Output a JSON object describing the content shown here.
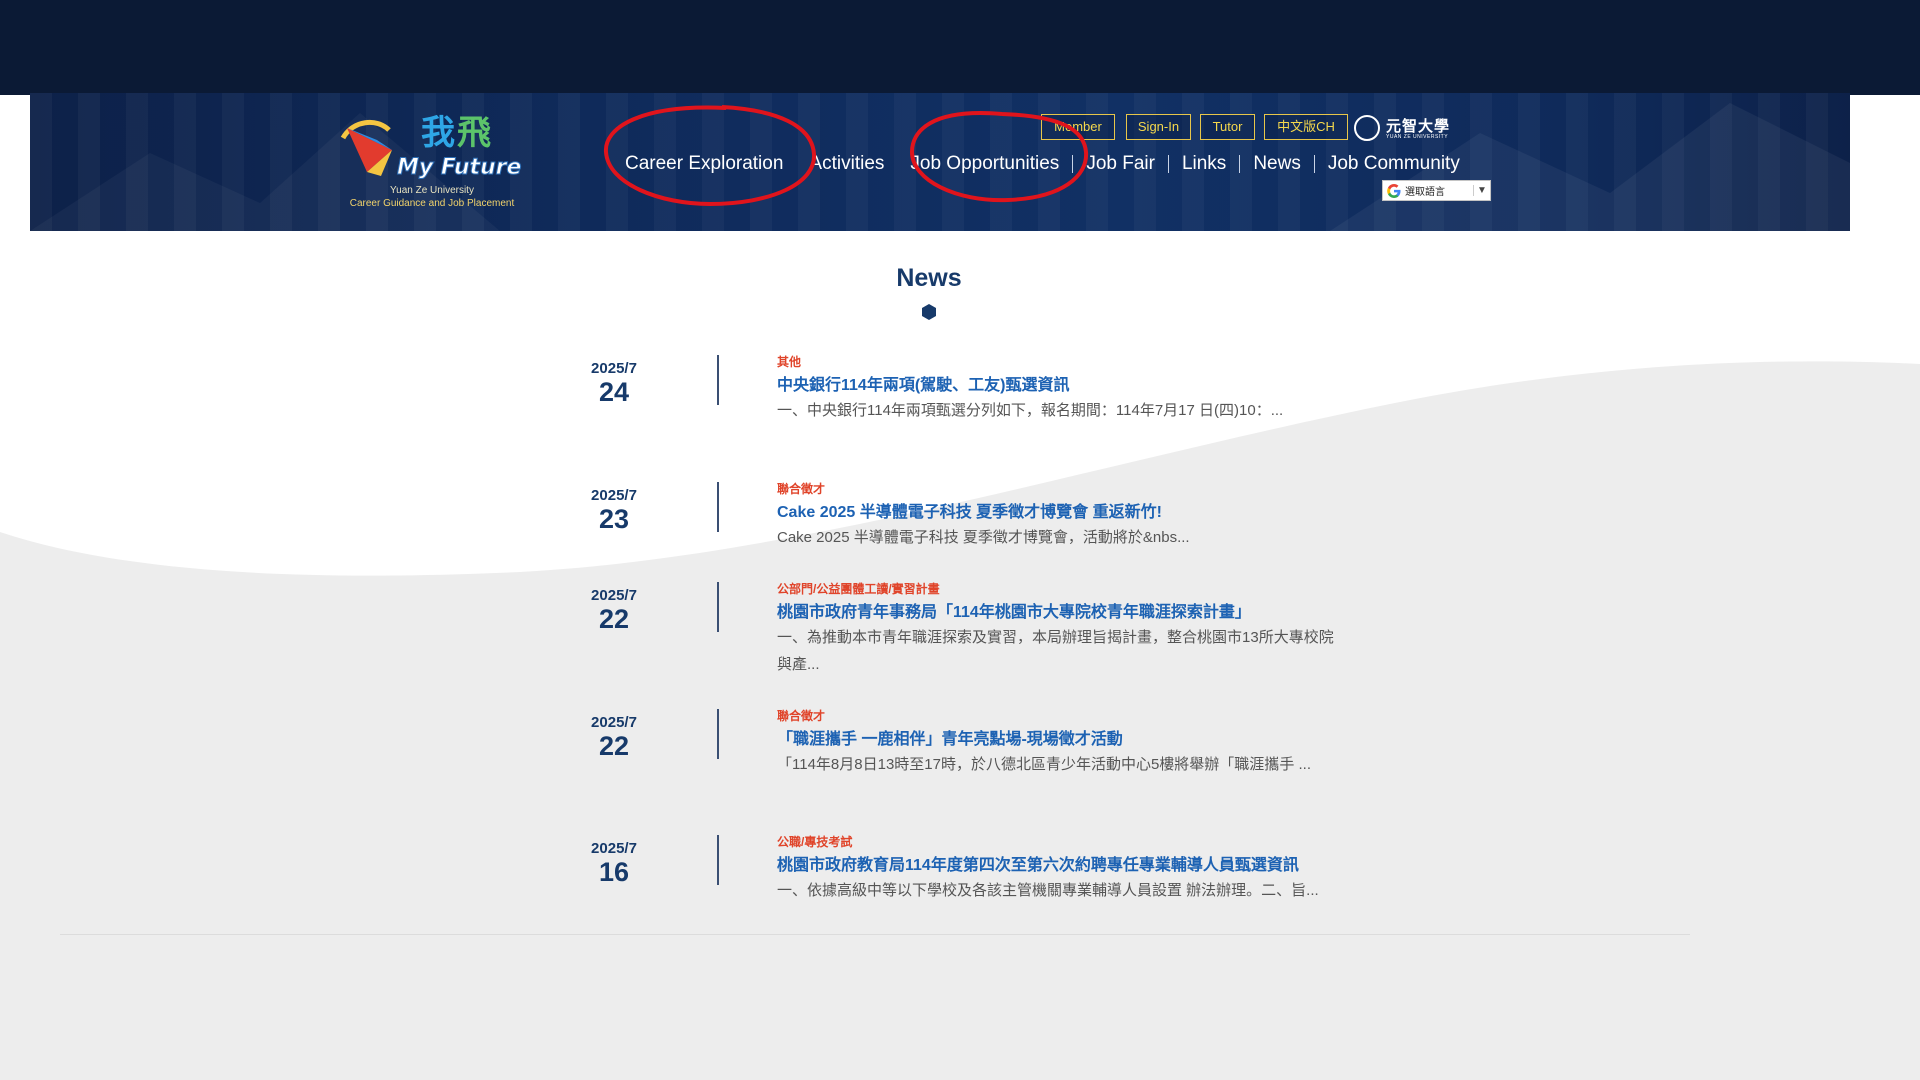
{
  "logo": {
    "line1": "Yuan Ze University",
    "line2": "Career Guidance and Job Placement",
    "art_text": "我飛",
    "art_sub": "My Future"
  },
  "utility": {
    "member": "Member",
    "signin": "Sign-In",
    "tutor": "Tutor",
    "chinese": "中文版CH"
  },
  "university": {
    "name": "元智大學",
    "sub": "YUAN ZE UNIVERSITY"
  },
  "nav": {
    "items": [
      "Career Exploration",
      "Activities",
      "Job Opportunities",
      "Job Fair",
      "Links",
      "News",
      "Job Community"
    ]
  },
  "translate": {
    "label": "選取語言",
    "caret": "▼"
  },
  "news": {
    "title": "News",
    "items": [
      {
        "year_month": "2025/7",
        "day": "24",
        "category": "其他",
        "headline": "中央銀行114年兩項(駕駛、工友)甄選資訊",
        "excerpt": "一、中央銀行114年兩項甄選分列如下，報名期間：114年7月17 日(四)10：..."
      },
      {
        "year_month": "2025/7",
        "day": "23",
        "category": "聯合徵才",
        "headline": "Cake 2025 半導體電子科技 夏季徵才博覽會 重返新竹!",
        "excerpt": " Cake 2025 半導體電子科技 夏季徵才博覽會，活動將於&nbs..."
      },
      {
        "year_month": "2025/7",
        "day": "22",
        "category": "公部門/公益團體工讀/實習計畫",
        "headline": "桃園市政府青年事務局「114年桃園市大專院校青年職涯探索計畫」",
        "excerpt": "一、為推動本市青年職涯探索及實習，本局辦理旨揭計畫，整合桃園市13所大專校院與產..."
      },
      {
        "year_month": "2025/7",
        "day": "22",
        "category": "聯合徵才",
        "headline": "「職涯攜手 一鹿相伴」青年亮點場-現場徵才活動",
        "excerpt": "「114年8月8日13時至17時，於八德北區青少年活動中心5樓將舉辦「職涯攜手 ..."
      },
      {
        "year_month": "2025/7",
        "day": "16",
        "category": "公職/專技考試",
        "headline": "桃園市政府教育局114年度第四次至第六次約聘專任專業輔導人員甄選資訊",
        "excerpt": "一、依據高級中等以下學校及各該主管機關專業輔導人員設置 辦法辦理。二、旨..."
      }
    ]
  },
  "colors": {
    "header": "#0f2a5a",
    "accent_gold": "#f5d84c",
    "title_navy": "#173a6a",
    "link_blue": "#1d62b3",
    "category_red": "#e0442a",
    "annotation_red": "#e0141c"
  }
}
